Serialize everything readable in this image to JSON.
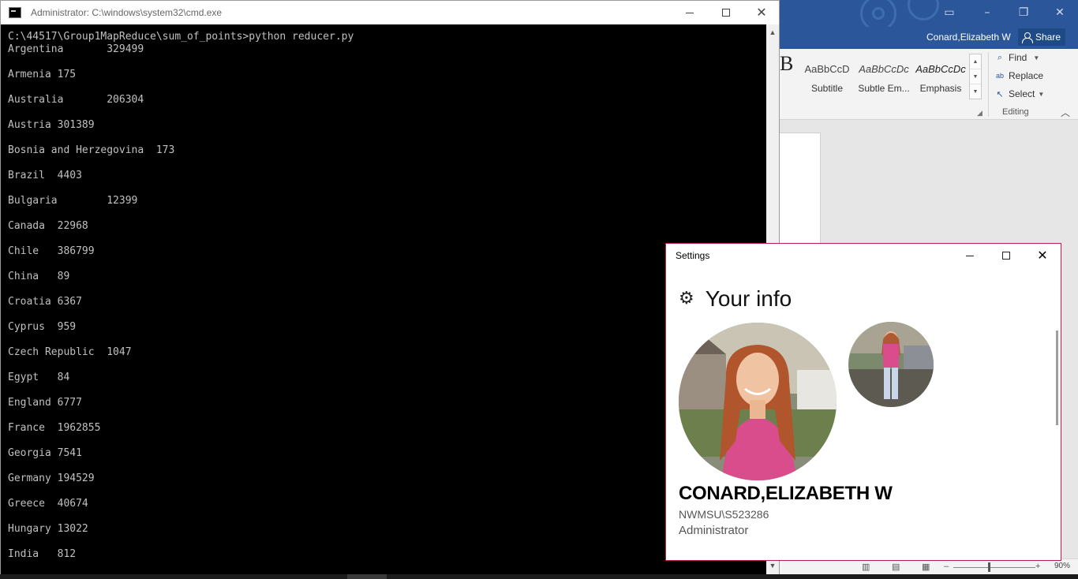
{
  "word": {
    "user_name": "Conard,Elizabeth W",
    "share_label": "Share",
    "style_partial": "B",
    "styles": [
      {
        "sample": "AaBbCcD",
        "name": "Subtitle",
        "italic": false
      },
      {
        "sample": "AaBbCcDc",
        "name": "Subtle Em...",
        "italic": true
      },
      {
        "sample": "AaBbCcDc",
        "name": "Emphasis",
        "italic": true
      }
    ],
    "editing": {
      "find_label": "Find",
      "replace_label": "Replace",
      "select_label": "Select",
      "group_label": "Editing"
    },
    "zoom": "90%"
  },
  "cmd": {
    "title": "Administrator: C:\\windows\\system32\\cmd.exe",
    "command": "C:\\44517\\Group1MapReduce\\sum_of_points>python reducer.py",
    "output": [
      "Argentina       329499",
      "",
      "Armenia 175",
      "",
      "Australia       206304",
      "",
      "Austria 301389",
      "",
      "Bosnia and Herzegovina  173",
      "",
      "Brazil  4403",
      "",
      "Bulgaria        12399",
      "",
      "Canada  22968",
      "",
      "Chile   386799",
      "",
      "China   89",
      "",
      "Croatia 6367",
      "",
      "Cyprus  959",
      "",
      "Czech Republic  1047",
      "",
      "Egypt   84",
      "",
      "England 6777",
      "",
      "France  1962855",
      "",
      "Georgia 7541",
      "",
      "Germany 194529",
      "",
      "Greece  40674",
      "",
      "Hungary 13022",
      "",
      "India   812"
    ]
  },
  "settings": {
    "window_title": "Settings",
    "heading": "Your info",
    "user_display_name": "CONARD,ELIZABETH W",
    "account": "NWMSU\\S523286",
    "role": "Administrator"
  },
  "icons": {
    "gear": "⚙",
    "close": "✕",
    "scroll_up": "▲",
    "scroll_down": "▼"
  },
  "colors": {
    "word_brand": "#2b579a",
    "settings_border": "#c2185b",
    "console_bg": "#000000",
    "console_text": "#c0c0c0"
  }
}
